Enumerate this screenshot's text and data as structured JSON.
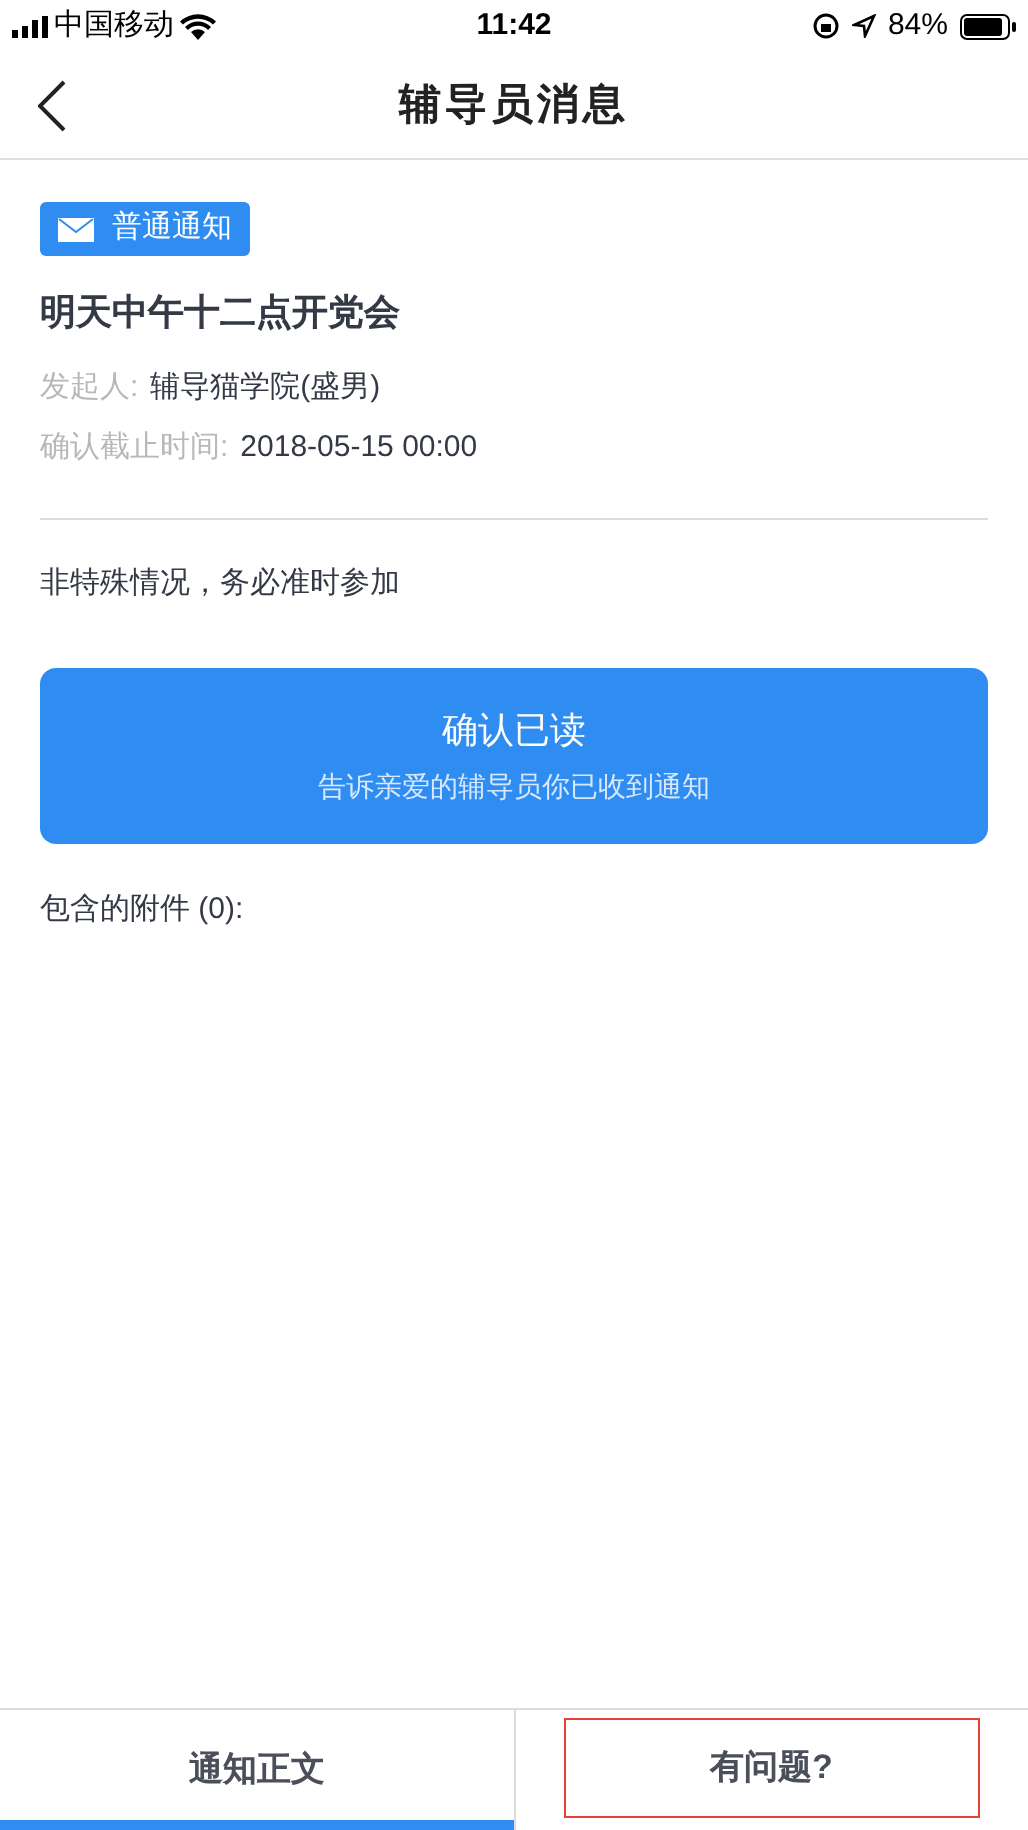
{
  "status_bar": {
    "carrier": "中国移动",
    "time": "11:42",
    "battery": "84%"
  },
  "nav": {
    "title": "辅导员消息"
  },
  "message": {
    "tag": "普通通知",
    "title": "明天中午十二点开党会",
    "fields": [
      {
        "label": "发起人:",
        "value": "辅导猫学院(盛男)"
      },
      {
        "label": "确认截止时间:",
        "value": "2018-05-15 00:00"
      }
    ],
    "body": "非特殊情况，务必准时参加",
    "confirm_button": {
      "title": "确认已读",
      "subtitle": "告诉亲爱的辅导员你已收到通知"
    },
    "attachments": "包含的附件 (0):"
  },
  "tabs": [
    {
      "label": "通知正文",
      "selected": true,
      "highlighted": false
    },
    {
      "label": "有问题?",
      "selected": false,
      "highlighted": true
    }
  ]
}
